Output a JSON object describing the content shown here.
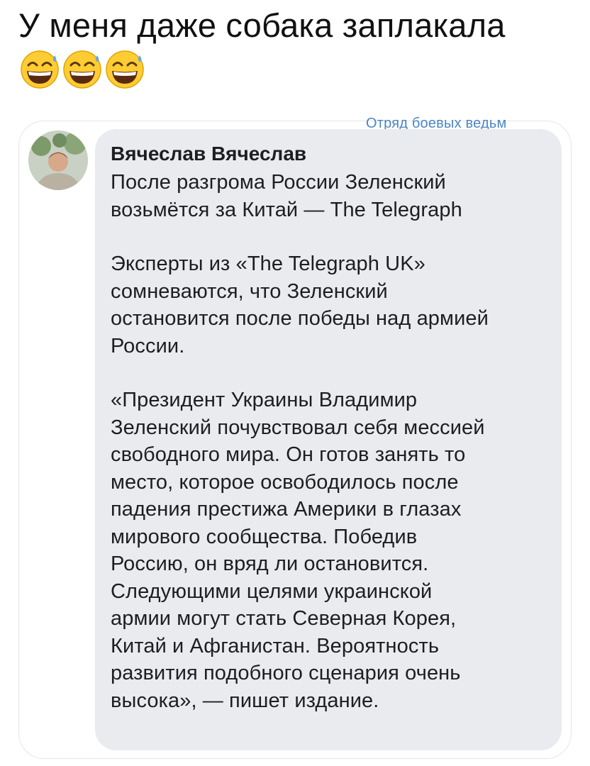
{
  "post": {
    "caption": "У меня даже собака заплакала",
    "emojis": [
      "grinning-sweat-face",
      "grinning-sweat-face",
      "grinning-sweat-face"
    ]
  },
  "screenshot": {
    "watermark": "Отряд боевых ведьм",
    "comment": {
      "author": "Вячеслав Вячеслав",
      "paragraphs": [
        "После разгрома России Зеленский\nвозьмётся за Китай — The Telegraph",
        "Эксперты из «The Telegraph UK»\nсомневаются, что Зеленский\nостановится после победы над армией\nРоссии.",
        "«Президент Украины Владимир\nЗеленский почувствовал себя мессией\nсвободного мира. Он готов занять то\nместо, которое освободилось после\nпадения престижа Америки в глазах\nмирового сообщества. Победив\nРоссию, он вряд ли остановится.\nСледующими целями украинской\nармии могут стать Северная Корея,\nКитай и Афганистан. Вероятность\nразвития подобного сценария очень\nвысока», — пишет издание."
      ]
    }
  },
  "colors": {
    "bubble": "#e9ebee",
    "watermark": "#4a86c5",
    "text": "#1c1e21",
    "emoji_face": "#ffcc33"
  }
}
